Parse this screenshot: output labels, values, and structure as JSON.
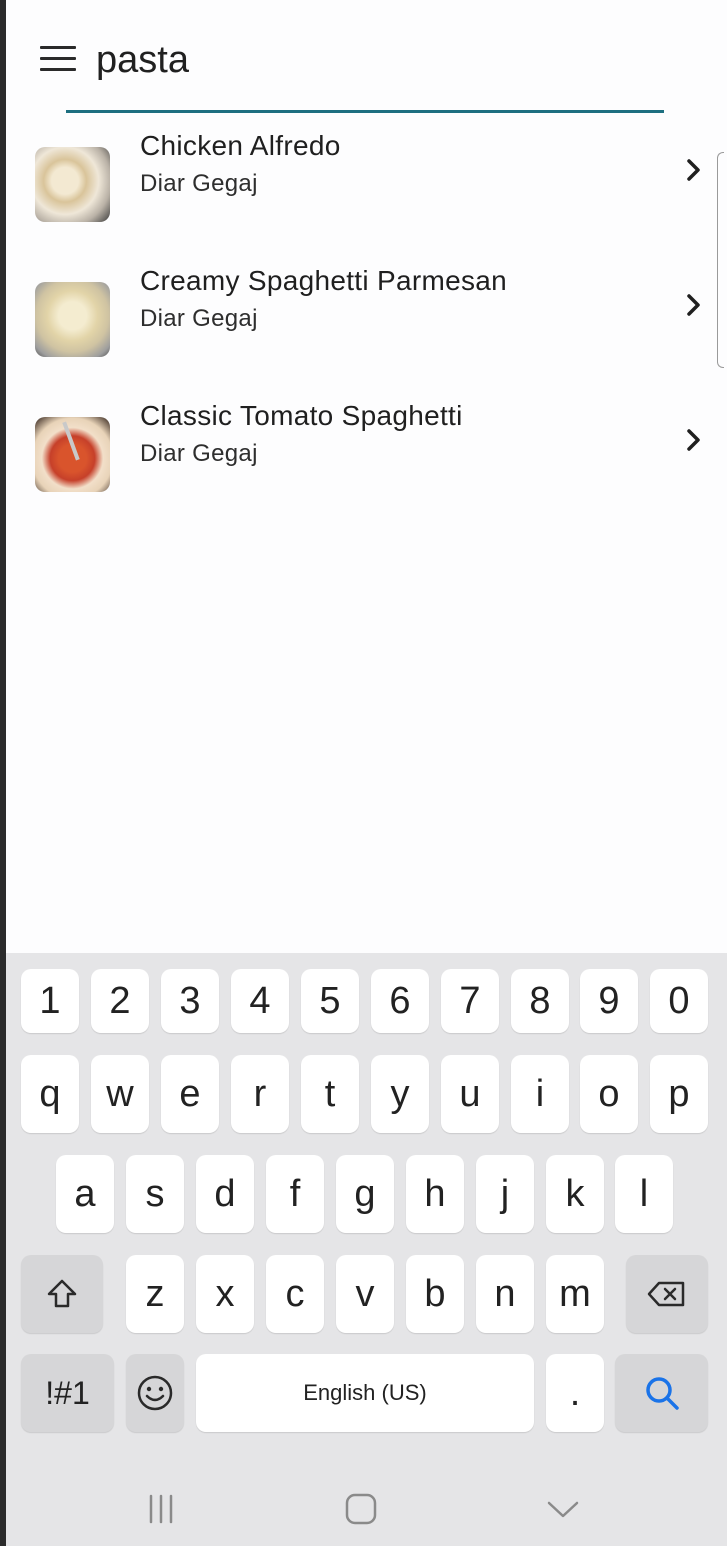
{
  "search": {
    "value": "pasta",
    "placeholder": ""
  },
  "results": [
    {
      "title": "Chicken Alfredo",
      "author": "Diar Gegaj"
    },
    {
      "title": "Creamy Spaghetti Parmesan",
      "author": "Diar Gegaj"
    },
    {
      "title": "Classic Tomato Spaghetti",
      "author": "Diar Gegaj"
    }
  ],
  "keyboard": {
    "numbers": [
      "1",
      "2",
      "3",
      "4",
      "5",
      "6",
      "7",
      "8",
      "9",
      "0"
    ],
    "row1": [
      "q",
      "w",
      "e",
      "r",
      "t",
      "y",
      "u",
      "i",
      "o",
      "p"
    ],
    "row2": [
      "a",
      "s",
      "d",
      "f",
      "g",
      "h",
      "j",
      "k",
      "l"
    ],
    "row3": [
      "z",
      "x",
      "c",
      "v",
      "b",
      "n",
      "m"
    ],
    "symbols_label": "!#1",
    "space_label": "English (US)",
    "period_label": "."
  },
  "colors": {
    "accent": "#1d6f80",
    "search_key_icon": "#1a73e8"
  },
  "icons": [
    "menu-icon",
    "chevron-right-icon",
    "shift-icon",
    "backspace-icon",
    "emoji-icon",
    "search-icon",
    "recents-icon",
    "home-icon",
    "back-icon"
  ]
}
